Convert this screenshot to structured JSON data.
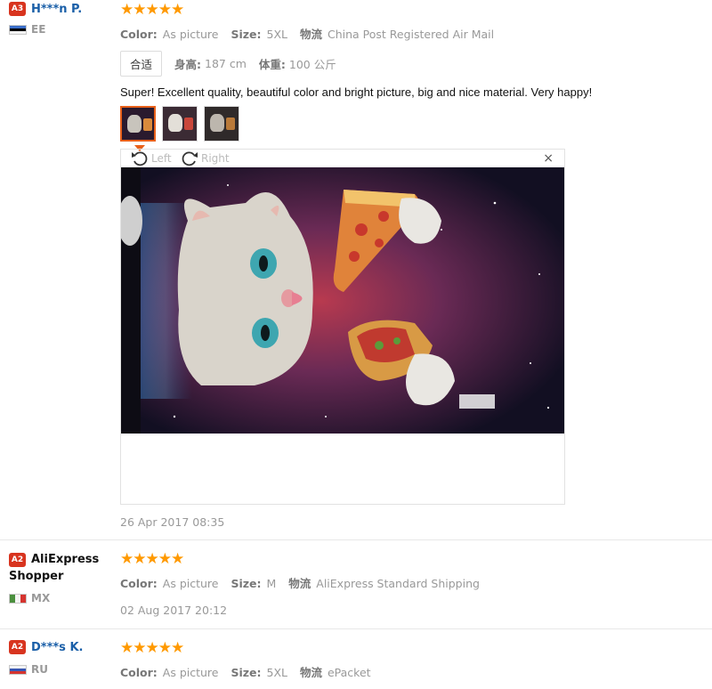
{
  "reviews": [
    {
      "level": "A3",
      "name": "H***n P.",
      "country": "EE",
      "stars": "★★★★★",
      "color_label": "Color:",
      "color_value": "As picture",
      "size_label": "Size:",
      "size_value": "5XL",
      "shipping_label": "物流",
      "shipping_value": "China Post Registered Air Mail",
      "fit_tag": "合适",
      "height_label": "身高:",
      "height_value": "187 cm",
      "weight_label": "体重:",
      "weight_value": "100 公斤",
      "text": "Super! Excellent quality, beautiful color and bright picture, big and nice material. Very happy!",
      "date": "26 Apr 2017 08:35",
      "viewer": {
        "rotate_left": "Left",
        "rotate_right": "Right",
        "close": "×"
      }
    },
    {
      "level": "A2",
      "name": "AliExpress Shopper",
      "country": "MX",
      "stars": "★★★★★",
      "color_label": "Color:",
      "color_value": "As picture",
      "size_label": "Size:",
      "size_value": "M",
      "shipping_label": "物流",
      "shipping_value": "AliExpress Standard Shipping",
      "date": "02 Aug 2017 20:12"
    },
    {
      "level": "A2",
      "name": "D***s K.",
      "country": "RU",
      "stars": "★★★★★",
      "color_label": "Color:",
      "color_value": "As picture",
      "size_label": "Size:",
      "size_value": "5XL",
      "shipping_label": "物流",
      "shipping_value": "ePacket"
    }
  ],
  "colors": {
    "badge": "#d8341f",
    "name_link": "#1a5fa8",
    "star": "#ff9900",
    "thumb_active": "#e8601a"
  }
}
